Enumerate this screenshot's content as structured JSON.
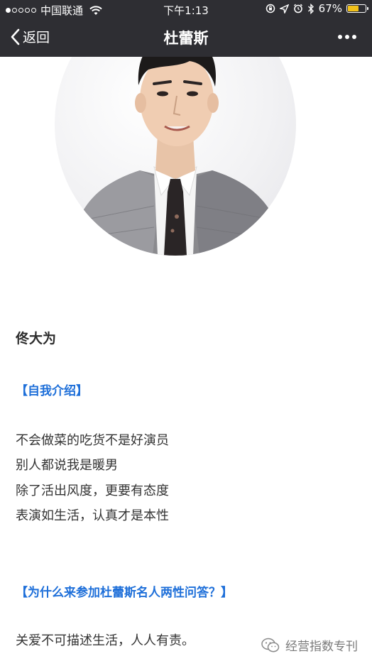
{
  "status_bar": {
    "carrier": "中国联通",
    "time": "下午1:13",
    "battery_percent": "67%",
    "battery_level": 0.67,
    "battery_color": "#f2c21a"
  },
  "nav": {
    "back_label": "返回",
    "title": "杜蕾斯"
  },
  "article": {
    "name": "佟大为",
    "section1_heading": "【自我介绍】",
    "intro_lines": [
      "不会做菜的吃货不是好演员",
      "别人都说我是暖男",
      "除了活出风度，更要有态度",
      "表演如生活，认真才是本性"
    ],
    "section2_heading": "【为什么来参加杜蕾斯名人两性问答？】",
    "answer": "关爱不可描述生活，人人有责。"
  },
  "watermark": {
    "label": "经营指数专刊"
  },
  "colors": {
    "header_bg": "#2e2e33",
    "accent": "#1e6fd9"
  }
}
